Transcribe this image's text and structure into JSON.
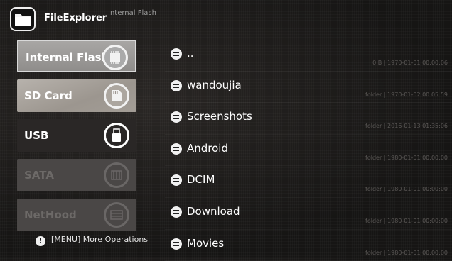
{
  "app": {
    "title": "FileExplorer",
    "location": "Internal Flash"
  },
  "sidebar": {
    "items": [
      {
        "label": "Internal Flash",
        "icon": "memory-chip-icon",
        "state": "selected"
      },
      {
        "label": "SD Card",
        "icon": "sd-card-icon",
        "state": "normal"
      },
      {
        "label": "USB",
        "icon": "usb-drive-icon",
        "state": "normal"
      },
      {
        "label": "SATA",
        "icon": "hard-disk-icon",
        "state": "disabled"
      },
      {
        "label": "NetHood",
        "icon": "network-icon",
        "state": "disabled"
      }
    ]
  },
  "menu_hint": "[MENU] More Operations",
  "files": [
    {
      "name": "..",
      "meta": "0 B | 1970-01-01 00:00:06"
    },
    {
      "name": "wandoujia",
      "meta": "folder | 1970-01-02 00:05:59"
    },
    {
      "name": "Screenshots",
      "meta": "folder | 2016-01-13 01:35:06"
    },
    {
      "name": "Android",
      "meta": "folder | 1980-01-01 00:00:00"
    },
    {
      "name": "DCIM",
      "meta": "folder | 1980-01-01 00:00:00"
    },
    {
      "name": "Download",
      "meta": "folder | 1980-01-01 00:00:00"
    },
    {
      "name": "Movies",
      "meta": "folder | 1980-01-01 00:00:00"
    }
  ]
}
